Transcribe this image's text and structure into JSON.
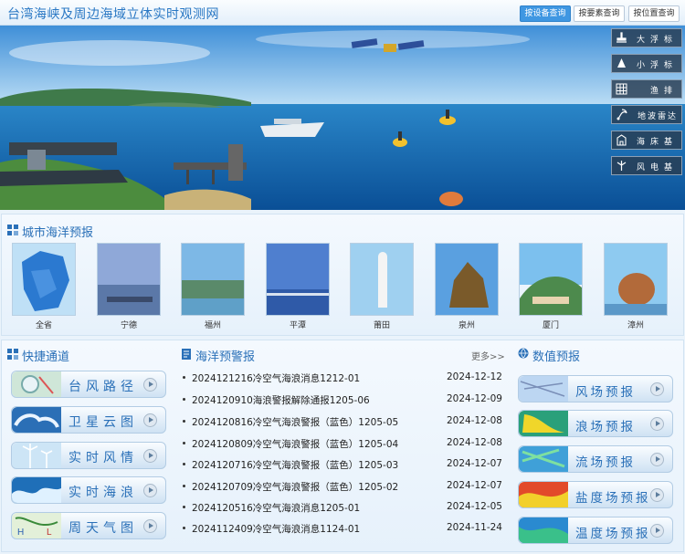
{
  "header": {
    "title": "台湾海峡及周边海域立体实时观测网",
    "buttons": [
      {
        "label": "按设备查询",
        "active": true
      },
      {
        "label": "按要素查询",
        "active": false
      },
      {
        "label": "按位置查询",
        "active": false
      }
    ]
  },
  "hero": {
    "side_menu": [
      {
        "label": "大浮标",
        "icon": "large-buoy-icon"
      },
      {
        "label": "小浮标",
        "icon": "small-buoy-icon"
      },
      {
        "label": "渔排",
        "icon": "fish-raft-icon"
      },
      {
        "label": "地波雷达",
        "icon": "radar-icon"
      },
      {
        "label": "海床基",
        "icon": "seabed-base-icon"
      },
      {
        "label": "风电基",
        "icon": "wind-turbine-icon"
      }
    ]
  },
  "city_forecast": {
    "title": "城市海洋预报",
    "cities": [
      "全省",
      "宁德",
      "福州",
      "平潭",
      "莆田",
      "泉州",
      "厦门",
      "漳州"
    ]
  },
  "quick_links": {
    "title": "快捷通道",
    "items": [
      "台风路径",
      "卫星云图",
      "实时风情",
      "实时海浪",
      "周天气图"
    ]
  },
  "warnings": {
    "title": "海洋预警报",
    "more": "更多>>",
    "items": [
      {
        "title": "20241212​16冷空气海浪消息1212-01",
        "date": "2024-12-12"
      },
      {
        "title": "2024120910海浪警报解除通报1205-06",
        "date": "2024-12-09"
      },
      {
        "title": "2024120816冷空气海浪警报（蓝色）1205-05",
        "date": "2024-12-08"
      },
      {
        "title": "2024120809冷空气海浪警报（蓝色）1205-04",
        "date": "2024-12-08"
      },
      {
        "title": "2024120716冷空气海浪警报（蓝色）1205-03",
        "date": "2024-12-07"
      },
      {
        "title": "2024120709冷空气海浪警报（蓝色）1205-02",
        "date": "2024-12-07"
      },
      {
        "title": "2024120516冷空气海浪消息1205-01",
        "date": "2024-12-05"
      },
      {
        "title": "2024112409冷空气海浪消息1124-01",
        "date": "2024-11-24"
      }
    ]
  },
  "numeric_forecast": {
    "title": "数值预报",
    "items": [
      "风场预报",
      "浪场预报",
      "流场预报",
      "盐度场预报",
      "温度场预报"
    ]
  },
  "colors": {
    "accent": "#2a70b8",
    "active_button": "#3f97e2",
    "page_bg": "#eaf3fb"
  }
}
